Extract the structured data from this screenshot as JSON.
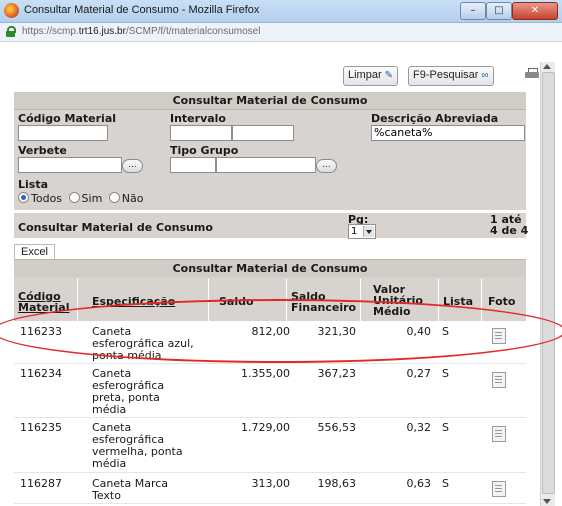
{
  "window": {
    "title": "Consultar Material de Consumo - Mozilla Firefox",
    "url_prefix": "https://scmp.",
    "url_domain": "trt16.jus.br",
    "url_path": "/SCMP/f/t/materialconsumosel"
  },
  "toolbar": {
    "limpar_label": "Limpar",
    "pesquisar_label": "F9-Pesquisar"
  },
  "filter_panel": {
    "title": "Consultar Material de Consumo",
    "codigo_label": "Código Material",
    "codigo_value": "",
    "intervalo_label": "Intervalo",
    "intervalo_start": "",
    "intervalo_end": "",
    "descricao_label": "Descrição Abreviada",
    "descricao_value": "%caneta%",
    "verbete_label": "Verbete",
    "verbete_value": "",
    "tipo_grupo_label": "Tipo Grupo",
    "tipo_grupo_a": "",
    "tipo_grupo_b": "",
    "ellipsis": "...",
    "lista_label": "Lista",
    "lista_options": [
      "Todos",
      "Sim",
      "Não"
    ],
    "lista_selected": "Todos"
  },
  "results_bar": {
    "title": "Consultar Material de Consumo",
    "pg_label": "Pg:",
    "pg_value": "1",
    "count_line1": "1  até",
    "count_line2": "4  de 4"
  },
  "tabs": {
    "excel": "Excel"
  },
  "grid": {
    "title": "Consultar Material de Consumo",
    "columns": {
      "codigo_line1": "Código",
      "codigo_line2": "Material",
      "especificacao": "Especificação",
      "saldo": "Saldo",
      "saldo_fin_line1": "Saldo",
      "saldo_fin_line2": "Financeiro",
      "valor_line1": "Valor",
      "valor_line2": "Unitário",
      "valor_line3": "Médio",
      "lista": "Lista",
      "foto": "Foto"
    },
    "rows": [
      {
        "codigo": "116233",
        "spec": [
          "Caneta",
          "esferográfica azul,",
          "ponta média"
        ],
        "saldo": "812,00",
        "financeiro": "321,30",
        "valor": "0,40",
        "lista": "S"
      },
      {
        "codigo": "116234",
        "spec": [
          "Caneta",
          "esferográfica",
          "preta, ponta",
          "média"
        ],
        "saldo": "1.355,00",
        "financeiro": "367,23",
        "valor": "0,27",
        "lista": "S"
      },
      {
        "codigo": "116235",
        "spec": [
          "Caneta",
          "esferográfica",
          "vermelha, ponta",
          "média"
        ],
        "saldo": "1.729,00",
        "financeiro": "556,53",
        "valor": "0,32",
        "lista": "S"
      },
      {
        "codigo": "116287",
        "spec": [
          "Caneta Marca",
          "Texto"
        ],
        "saldo": "313,00",
        "financeiro": "198,63",
        "valor": "0,63",
        "lista": "S"
      }
    ]
  },
  "colors": {
    "panel_bg": "#d9d3cf",
    "annotation": "#e02a2a"
  }
}
